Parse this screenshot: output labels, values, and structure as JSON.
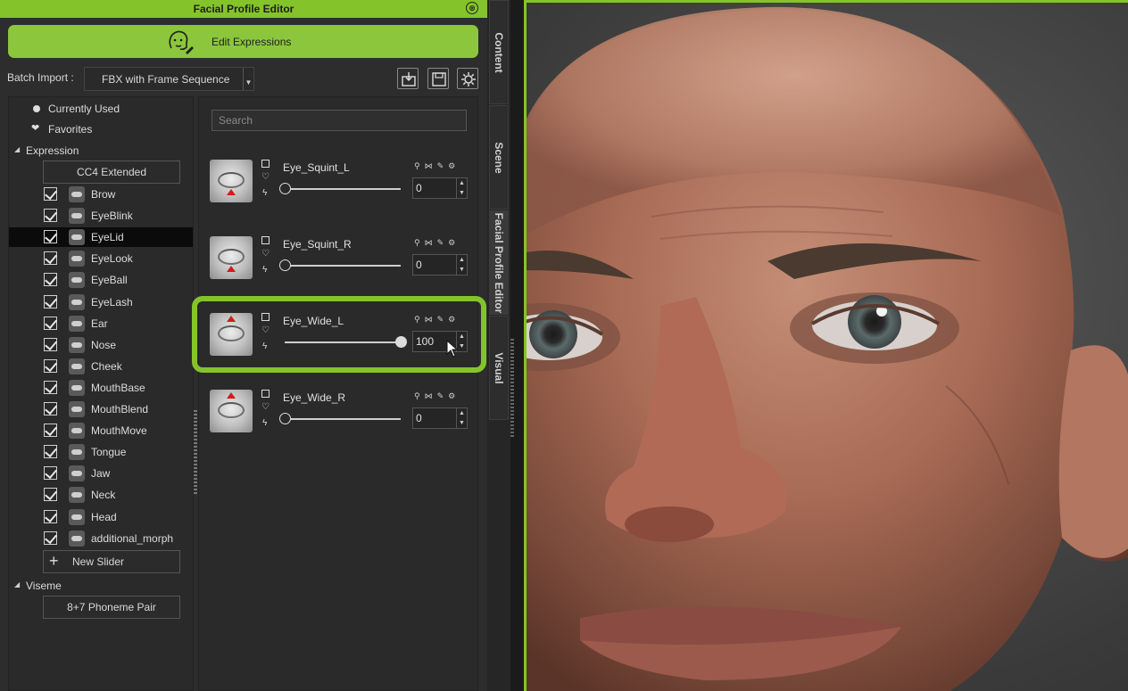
{
  "title_bar": {
    "title": "Facial Profile Editor",
    "close_glyph": "⊗"
  },
  "edit_button": {
    "label": "Edit Expressions",
    "icon": "face-edit-icon"
  },
  "batch_import": {
    "label": "Batch Import :",
    "value": "FBX with Frame Sequence"
  },
  "toolbar_icons": [
    "import-icon",
    "save-icon",
    "settings-icon"
  ],
  "tree": {
    "currently_used": "Currently Used",
    "favorites": "Favorites",
    "expression_header": "Expression",
    "cc4_button": "CC4 Extended",
    "categories": [
      {
        "label": "Brow",
        "checked": true
      },
      {
        "label": "EyeBlink",
        "checked": true
      },
      {
        "label": "EyeLid",
        "checked": true,
        "selected": true
      },
      {
        "label": "EyeLook",
        "checked": true
      },
      {
        "label": "EyeBall",
        "checked": true
      },
      {
        "label": "EyeLash",
        "checked": true
      },
      {
        "label": "Ear",
        "checked": true
      },
      {
        "label": "Nose",
        "checked": true
      },
      {
        "label": "Cheek",
        "checked": true
      },
      {
        "label": "MouthBase",
        "checked": true
      },
      {
        "label": "MouthBlend",
        "checked": true
      },
      {
        "label": "MouthMove",
        "checked": true
      },
      {
        "label": "Tongue",
        "checked": true
      },
      {
        "label": "Jaw",
        "checked": true
      },
      {
        "label": "Neck",
        "checked": true
      },
      {
        "label": "Head",
        "checked": true
      },
      {
        "label": "additional_morph",
        "checked": true
      }
    ],
    "new_slider": "New Slider",
    "viseme_header": "Viseme",
    "phoneme_button": "8+7 Phoneme Pair"
  },
  "search": {
    "placeholder": "Search"
  },
  "morphs": [
    {
      "name": "Eye_Squint_L",
      "value": "0",
      "fraction": 0,
      "arrow": "down"
    },
    {
      "name": "Eye_Squint_R",
      "value": "0",
      "fraction": 0,
      "arrow": "down"
    },
    {
      "name": "Eye_Wide_L",
      "value": "100",
      "fraction": 1,
      "arrow": "up"
    },
    {
      "name": "Eye_Wide_R",
      "value": "0",
      "fraction": 0,
      "arrow": "up"
    }
  ],
  "vertical_tabs": [
    "Content",
    "Scene",
    "Facial Profile Editor",
    "Visual"
  ],
  "colors": {
    "accent": "#84c42a",
    "panel": "#2d2d2d",
    "marker": "#d21b1b"
  }
}
